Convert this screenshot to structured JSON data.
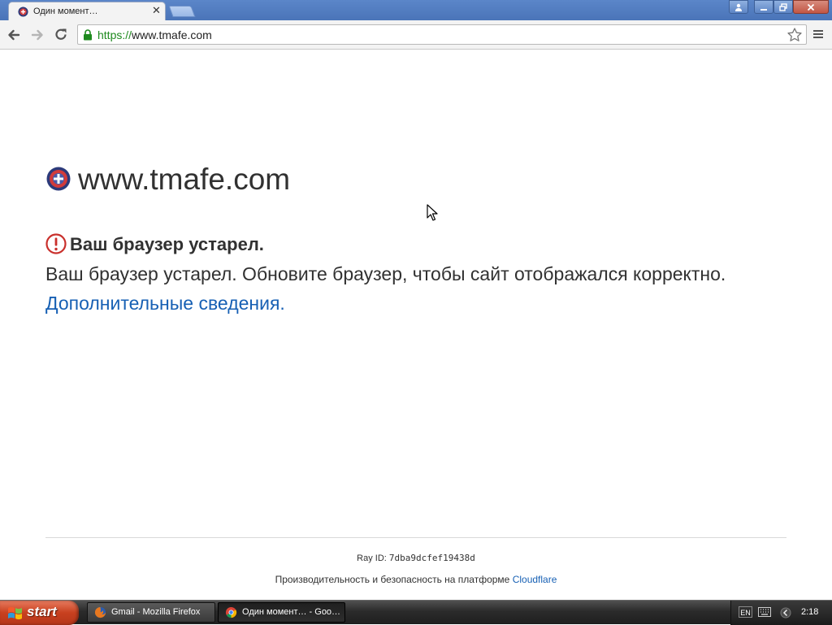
{
  "browser": {
    "tab": {
      "title": "Один момент…",
      "favicon": "site-favicon-icon"
    },
    "address": {
      "scheme": "https://",
      "host": "www.tmafe.com"
    }
  },
  "page": {
    "site_title": "www.tmafe.com",
    "warning_heading": "Ваш браузер устарел.",
    "warning_body": "Ваш браузер устарел. Обновите браузер, чтобы сайт отображался корректно.",
    "more_link": "Дополнительные сведения.",
    "footer": {
      "ray_label": "Ray ID:",
      "ray_id": "7dba9dcfef19438d",
      "performance_text": "Производительность и безопасность на платформе",
      "provider_link": "Cloudflare"
    }
  },
  "taskbar": {
    "start_label": "start",
    "tasks": [
      {
        "label": "Gmail - Mozilla Firefox",
        "icon": "firefox-icon",
        "active": false
      },
      {
        "label": "Один момент… - Goo…",
        "icon": "chrome-icon",
        "active": true
      }
    ],
    "language": "EN",
    "time": "2:18"
  },
  "colors": {
    "link": "#1760b4",
    "warning_icon": "#c9302c",
    "secure_scheme": "#1e8a1e"
  }
}
